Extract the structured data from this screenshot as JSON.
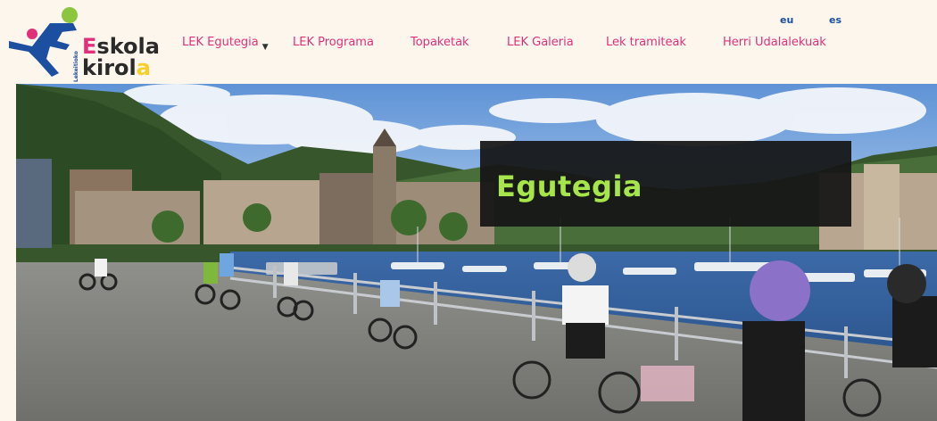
{
  "logo": {
    "line1_first": "E",
    "line1_rest": "skola",
    "line2_first": "kirol",
    "line2_last": "a",
    "side_text": "Lekeitioko"
  },
  "nav": {
    "items": [
      {
        "label": "LEK Egutegia",
        "has_dropdown": true
      },
      {
        "label": "LEK Programa"
      },
      {
        "label": "Topaketak"
      },
      {
        "label": "LEK Galeria"
      },
      {
        "label": "Lek tramiteak"
      },
      {
        "label": "Herri Udalalekuak"
      }
    ]
  },
  "languages": [
    "eu",
    "es"
  ],
  "hero": {
    "title": "Egutegia"
  },
  "colors": {
    "nav_text": "#e0307a",
    "lang_text": "#1d4fa0",
    "title_text": "#a6e64a",
    "title_bg": "#141414",
    "header_bg": "#fdf6ec"
  }
}
